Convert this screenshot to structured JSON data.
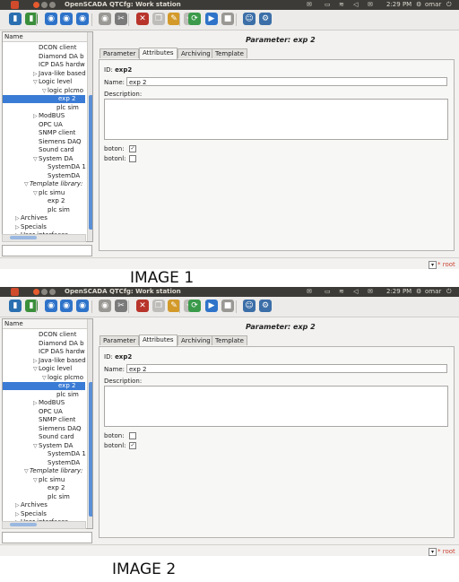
{
  "window_title": "OpenSCADA QTCfg: Work station",
  "tray": {
    "clock": "2:29 PM",
    "user": "omar"
  },
  "toolbar": [
    "db-load-icon",
    "db-save-icon",
    "home-icon",
    "up-icon",
    "prev-icon",
    "next-icon",
    "cut-icon",
    "delete-icon",
    "copy-icon",
    "paste-icon",
    "undo-icon",
    "refresh-icon",
    "start-icon",
    "stop-icon",
    "user-icon",
    "settings-icon"
  ],
  "tree": {
    "header": "Name",
    "rows": [
      {
        "label": "DCON client",
        "indent": 3
      },
      {
        "label": "Diamond DA b",
        "indent": 3
      },
      {
        "label": "ICP DAS hardw",
        "indent": 3
      },
      {
        "label": "Java-like based",
        "indent": 3,
        "arrow": "▷"
      },
      {
        "label": "Logic level",
        "indent": 3,
        "arrow": "▽"
      },
      {
        "label": "logic plcmo",
        "indent": 4,
        "arrow": "▽"
      },
      {
        "label": "exp 2",
        "indent": 5,
        "selected": true
      },
      {
        "label": "plc sim",
        "indent": 5
      },
      {
        "label": "ModBUS",
        "indent": 3,
        "arrow": "▷"
      },
      {
        "label": "OPC UA",
        "indent": 3
      },
      {
        "label": "SNMP client",
        "indent": 3
      },
      {
        "label": "Siemens DAQ",
        "indent": 3
      },
      {
        "label": "Sound card",
        "indent": 3
      },
      {
        "label": "System DA",
        "indent": 3,
        "arrow": "▽"
      },
      {
        "label": "SystemDA 1",
        "indent": 4
      },
      {
        "label": "SystemDA",
        "indent": 4
      },
      {
        "label": "Template library:",
        "indent": 2,
        "arrow": "▽",
        "italic": true
      },
      {
        "label": "plc simu",
        "indent": 3,
        "arrow": "▽"
      },
      {
        "label": "exp 2",
        "indent": 4
      },
      {
        "label": "plc sim",
        "indent": 4
      },
      {
        "label": "Archives",
        "indent": 1,
        "arrow": "▷"
      },
      {
        "label": "Specials",
        "indent": 1,
        "arrow": "▷"
      },
      {
        "label": "User interfaces",
        "indent": 1,
        "arrow": "▷"
      }
    ]
  },
  "param_title": "Parameter: exp 2",
  "tabs": [
    "Parameter",
    "Attributes",
    "Archiving",
    "Template config"
  ],
  "active_tab": "Attributes",
  "form": {
    "id_label": "ID:",
    "id_value": "exp2",
    "name_label": "Name:",
    "name_value": "exp 2",
    "desc_label": "Description:",
    "boton_label": "boton:",
    "botonl_label": "botonl:"
  },
  "statusbar": {
    "user": "root"
  },
  "shots": [
    {
      "caption": "IMAGE 1",
      "boton_checked": true,
      "botonl_checked": false
    },
    {
      "caption": "IMAGE 2",
      "boton_checked": false,
      "botonl_checked": true
    }
  ]
}
